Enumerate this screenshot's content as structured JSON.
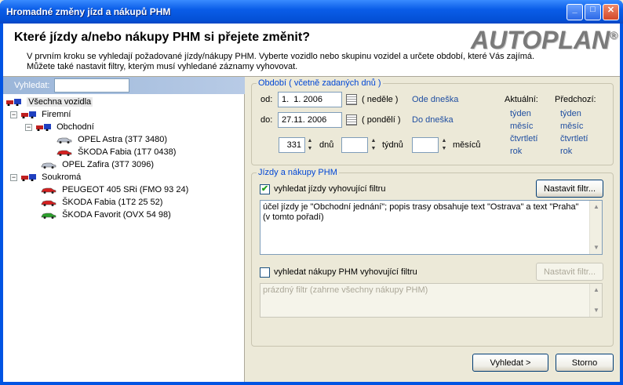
{
  "window": {
    "title": "Hromadné změny jízd a nákupů PHM",
    "minimize": "_",
    "maximize": "□",
    "close": "✕"
  },
  "header": {
    "question": "Které jízdy a/nebo nákupy PHM si přejete změnit?",
    "logo": "AUTOPLAN",
    "logo_mark": "®",
    "desc_line1": "V prvním kroku se vyhledají požadované jízdy/nákupy PHM. Vyberte vozidlo nebo skupinu vozidel a určete období, které Vás zajímá.",
    "desc_line2": "Můžete také nastavit filtry, kterým musí vyhledané záznamy vyhovovat."
  },
  "search": {
    "label": "Vyhledat:",
    "value": ""
  },
  "tree": {
    "all": "Všechna vozidla",
    "group_company": "Firemní",
    "group_business": "Obchodní",
    "car1": "OPEL Astra (3T7 3480)",
    "car2": "ŠKODA Fabia (1T7 0438)",
    "car3": "OPEL Zafira (3T7 3096)",
    "group_private": "Soukromá",
    "car4": "PEUGEOT 405 SRi (FMO 93 24)",
    "car5": "ŠKODA Fabia (1T2 25 52)",
    "car6": "ŠKODA Favorit (OVX 54 98)",
    "toggle_minus": "−"
  },
  "period": {
    "title": "Období ( včetně zadaných dnů )",
    "from_label": "od:",
    "from_value": "1.  1. 2006",
    "from_day": "( neděle )",
    "from_link": "Ode dneška",
    "to_label": "do:",
    "to_value": "27.11. 2006",
    "to_day": "( pondělí )",
    "to_link": "Do dneška",
    "days_value": "331",
    "days_label": "dnů",
    "weeks_value": "",
    "weeks_label": "týdnů",
    "months_value": "",
    "months_label": "měsíců",
    "current_title": "Aktuální:",
    "previous_title": "Předchozí:",
    "current_links": [
      "týden",
      "měsíc",
      "čtvrtletí",
      "rok"
    ],
    "previous_links": [
      "týden",
      "měsíc",
      "čtvrtletí",
      "rok"
    ],
    "spin_up": "▲",
    "spin_down": "▼"
  },
  "filters": {
    "title": "Jízdy a nákupy PHM",
    "trips_checkbox": "vyhledat jízdy vyhovující filtru",
    "trips_checked": true,
    "trips_button": "Nastavit filtr...",
    "trips_text": "účel jízdy je \"Obchodní jednání\";   popis trasy obsahuje text \"Ostrava\" a text \"Praha\" (v tomto pořadí)",
    "fuel_checkbox": "vyhledat nákupy PHM vyhovující filtru",
    "fuel_checked": false,
    "fuel_button": "Nastavit filtr...",
    "fuel_text": "prázdný filtr (zahrne všechny nákupy PHM)",
    "check_mark": "✔",
    "scroll_up": "▲",
    "scroll_down": "▼"
  },
  "buttons": {
    "search": "Vyhledat >",
    "cancel": "Storno"
  },
  "colors": {
    "title_blue": "#0054e3",
    "group_title": "#0046d5",
    "link": "#1f4ea1",
    "check": "#21a121"
  }
}
